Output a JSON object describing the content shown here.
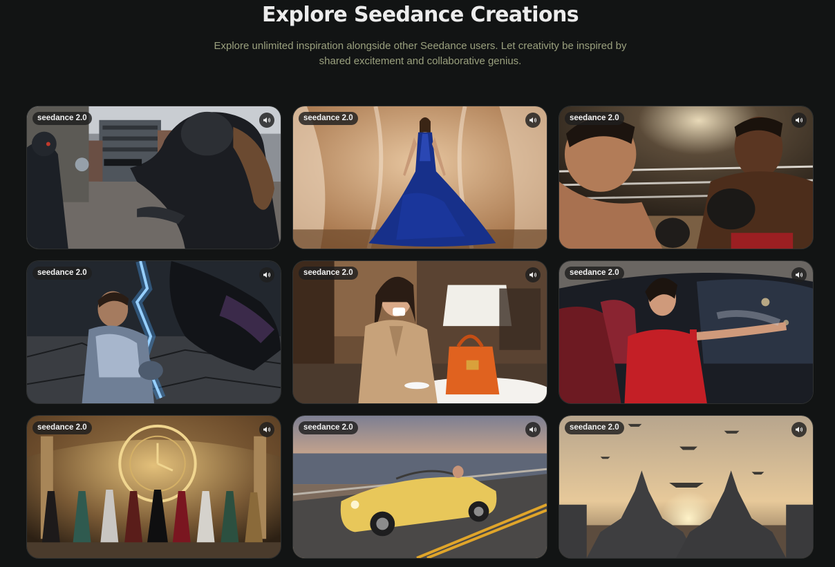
{
  "header": {
    "title": "Explore Seedance Creations",
    "subtitle": "Explore unlimited inspiration alongside other Seedance users. Let creativity be inspired by shared excitement and collaborative genius."
  },
  "cards": [
    {
      "badge": "seedance 2.0",
      "scene": "rooftop-gunfight",
      "icon": "speaker-icon"
    },
    {
      "badge": "seedance 2.0",
      "scene": "blue-gown-model",
      "icon": "speaker-icon"
    },
    {
      "badge": "seedance 2.0",
      "scene": "boxing-match",
      "icon": "speaker-icon"
    },
    {
      "badge": "seedance 2.0",
      "scene": "lightning-armor-hero",
      "icon": "speaker-icon"
    },
    {
      "badge": "seedance 2.0",
      "scene": "cafe-espresso-woman",
      "icon": "speaker-icon"
    },
    {
      "badge": "seedance 2.0",
      "scene": "red-dress-car-perfume",
      "icon": "speaker-icon"
    },
    {
      "badge": "seedance 2.0",
      "scene": "baroque-clock-hall",
      "icon": "speaker-icon"
    },
    {
      "badge": "seedance 2.0",
      "scene": "yellow-convertible-coast",
      "icon": "speaker-icon"
    },
    {
      "badge": "seedance 2.0",
      "scene": "battleships-sunset",
      "icon": "speaker-icon"
    }
  ],
  "colors": {
    "background": "#121414",
    "subtitle": "#9aa07e",
    "badge_bg": "#1e1e1e"
  }
}
